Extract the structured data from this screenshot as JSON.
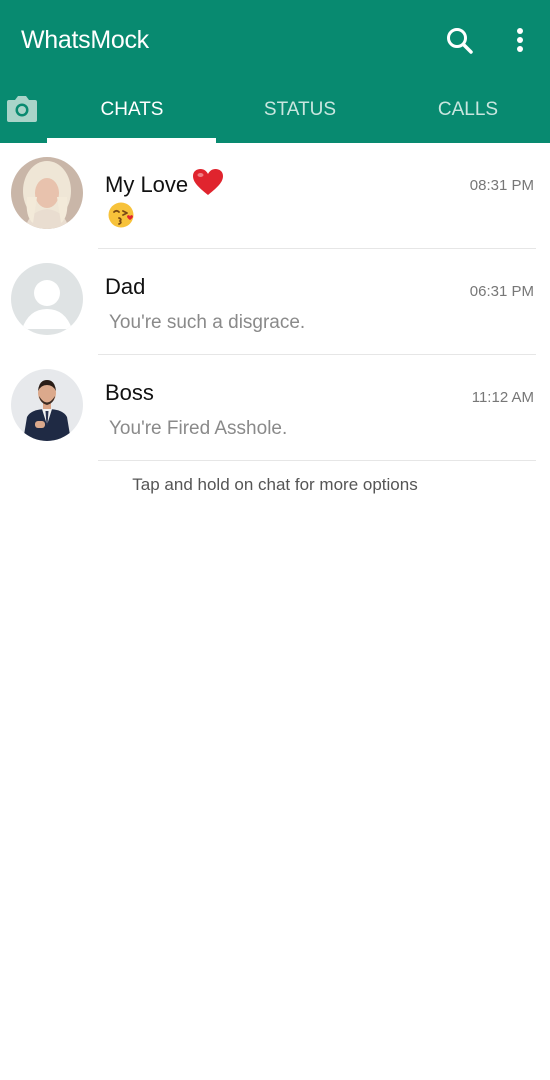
{
  "app": {
    "title": "WhatsMock"
  },
  "header": {
    "search_icon": "search-icon",
    "menu_icon": "more-vertical-icon"
  },
  "tabs": [
    {
      "label": "CHATS",
      "active": true
    },
    {
      "label": "STATUS",
      "active": false
    },
    {
      "label": "CALLS",
      "active": false
    }
  ],
  "camera_icon": "camera-icon",
  "chats": [
    {
      "name": "My Love",
      "name_emoji": "heart-icon",
      "time": "08:31 PM",
      "preview": "",
      "preview_emoji": "kiss-icon"
    },
    {
      "name": "Dad",
      "time": "06:31 PM",
      "preview": "You're such a disgrace."
    },
    {
      "name": "Boss",
      "time": "11:12 AM",
      "preview": "You're Fired Asshole."
    }
  ],
  "hint": "Tap and hold on chat for more options",
  "colors": {
    "primary": "#088a70",
    "tab_inactive": "#c9e6df",
    "text_secondary": "#8a8a8a",
    "divider": "#e6e6e6"
  }
}
